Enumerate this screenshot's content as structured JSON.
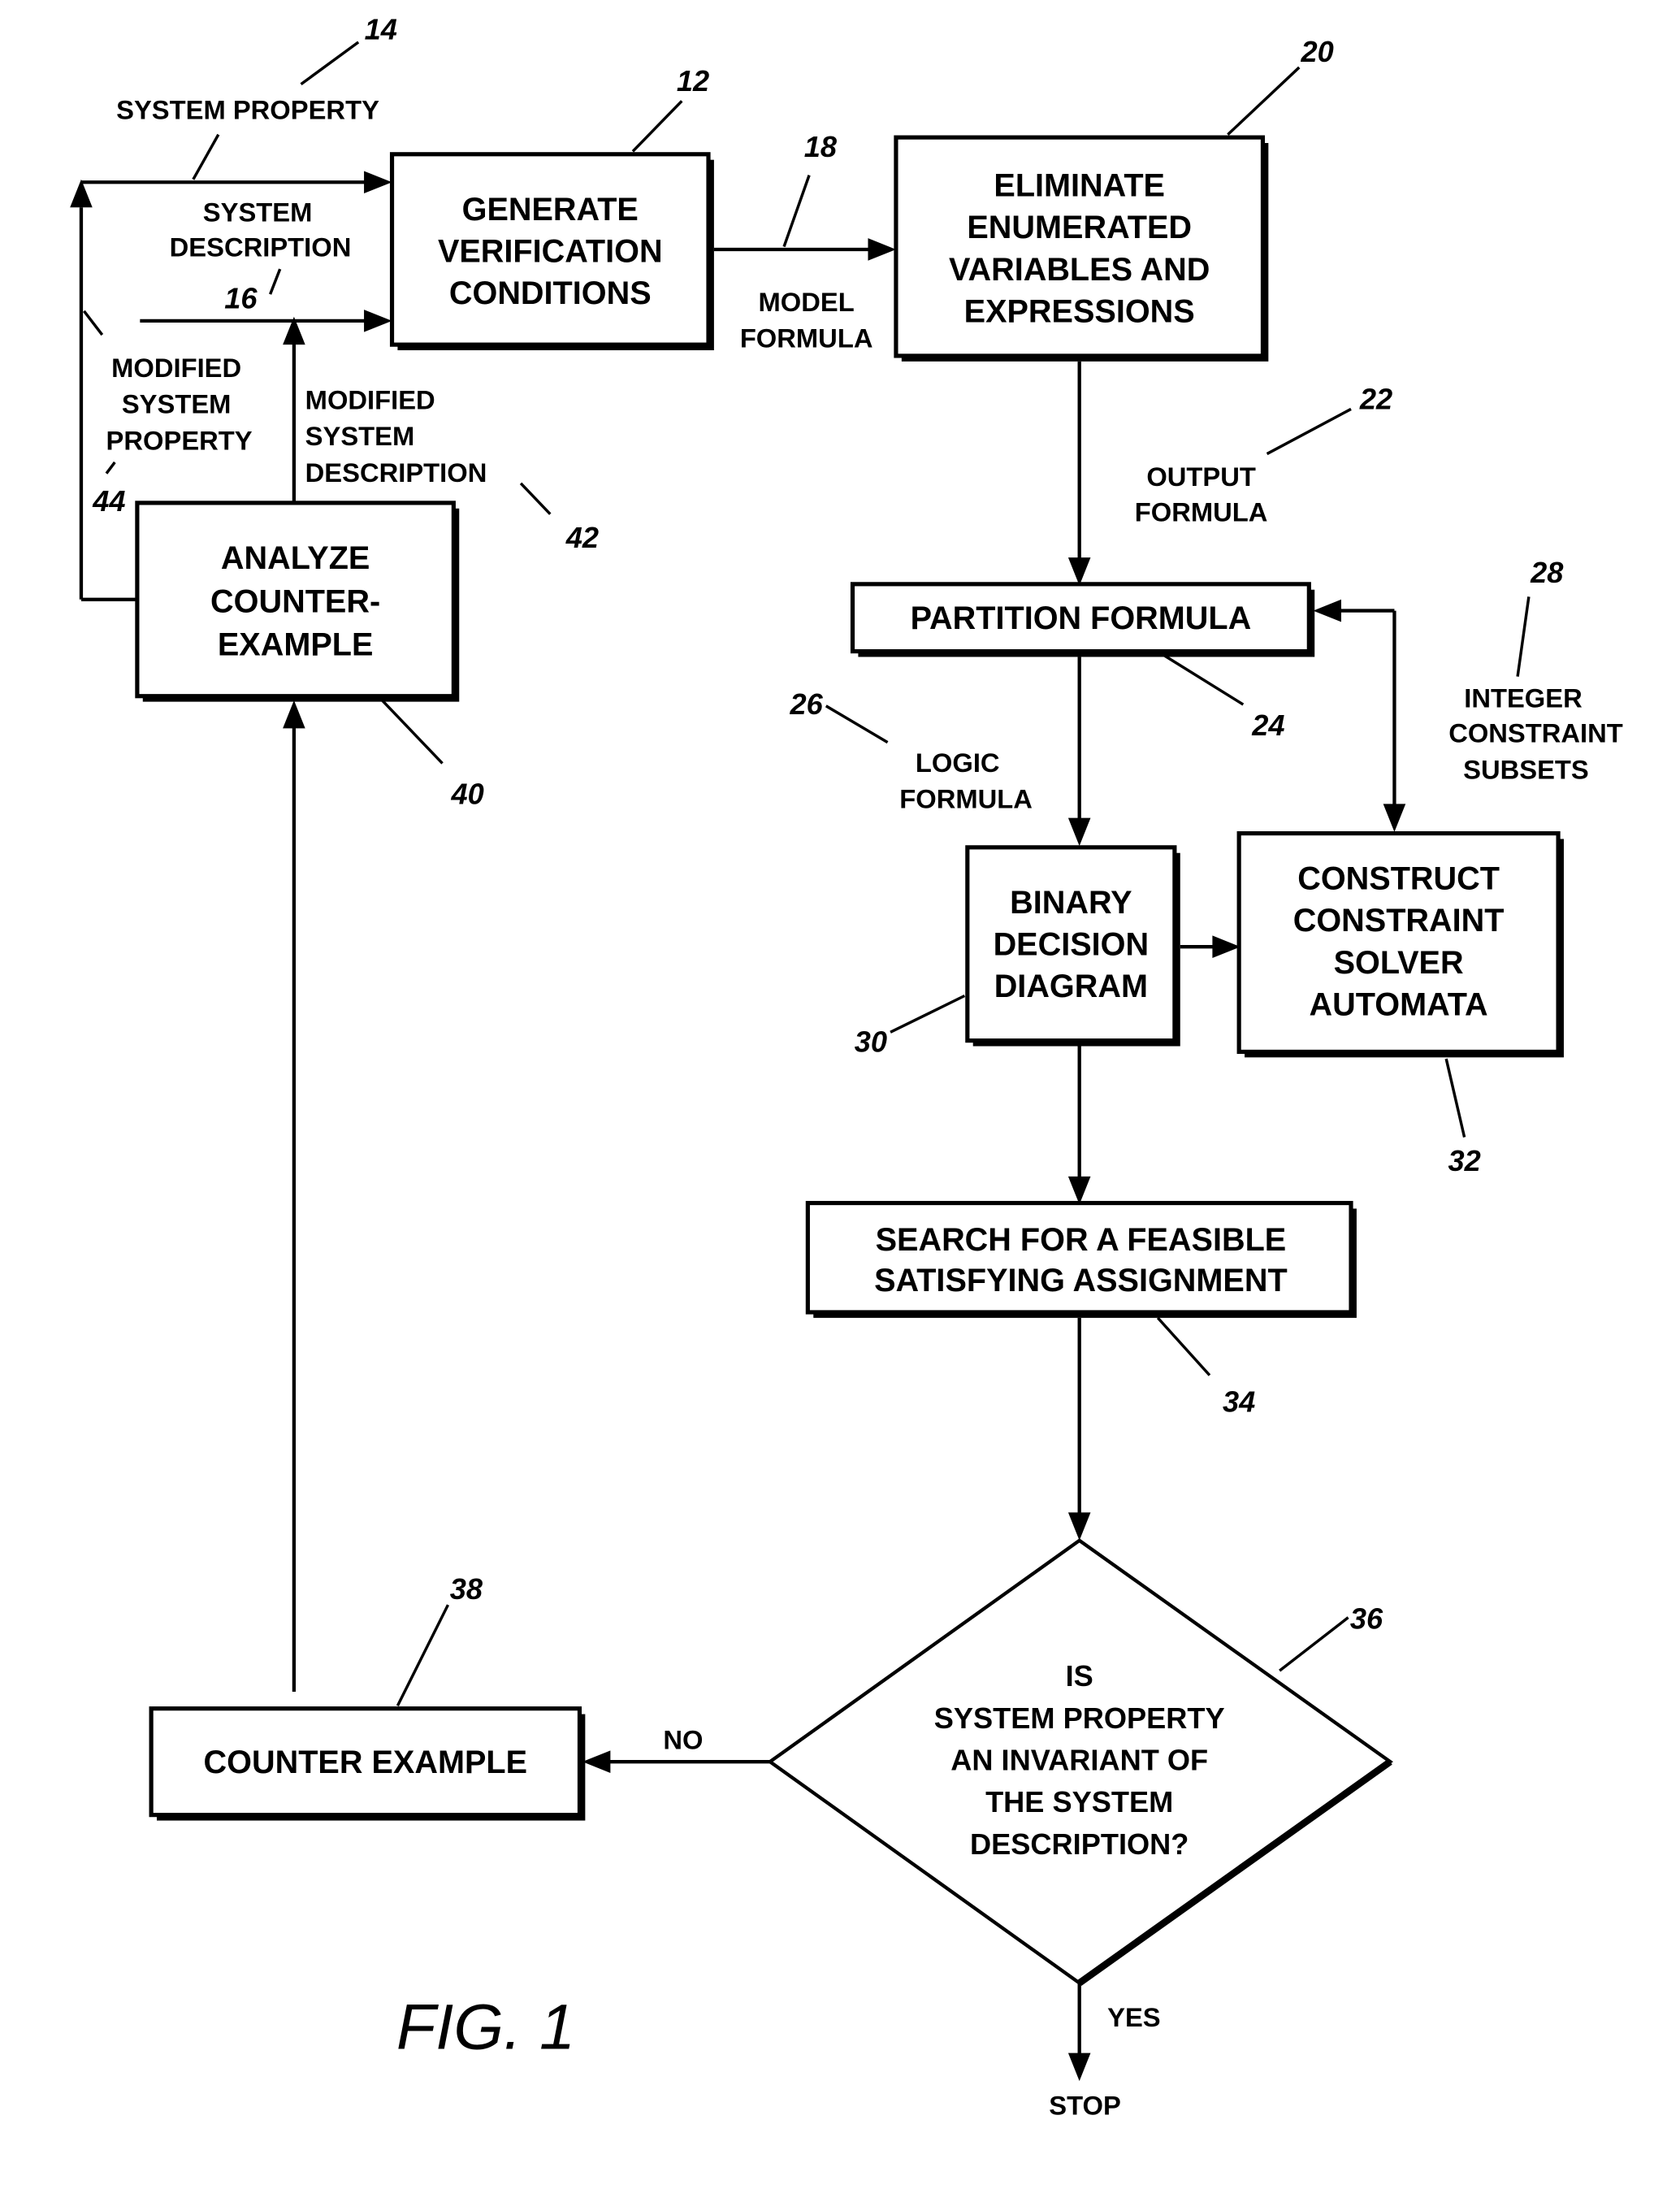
{
  "figure": {
    "caption": "FIG. 1"
  },
  "nodes": {
    "generate": {
      "ref": "12",
      "lines": [
        "GENERATE",
        "VERIFICATION",
        "CONDITIONS"
      ]
    },
    "eliminate": {
      "ref": "20",
      "lines": [
        "ELIMINATE",
        "ENUMERATED",
        "VARIABLES AND",
        "EXPRESSIONS"
      ]
    },
    "partition": {
      "ref": "24",
      "lines": [
        "PARTITION FORMULA"
      ]
    },
    "bdd": {
      "ref": "30",
      "lines": [
        "BINARY",
        "DECISION",
        "DIAGRAM"
      ]
    },
    "automata": {
      "ref": "32",
      "lines": [
        "CONSTRUCT",
        "CONSTRAINT",
        "SOLVER",
        "AUTOMATA"
      ]
    },
    "search": {
      "ref": "34",
      "lines": [
        "SEARCH FOR A FEASIBLE",
        "SATISFYING ASSIGNMENT"
      ]
    },
    "decision": {
      "ref": "36",
      "lines": [
        "IS",
        "SYSTEM PROPERTY",
        "AN INVARIANT OF",
        "THE SYSTEM",
        "DESCRIPTION?"
      ]
    },
    "counter": {
      "ref": "38",
      "lines": [
        "COUNTER EXAMPLE"
      ]
    },
    "analyze": {
      "ref": "40",
      "lines": [
        "ANALYZE",
        "COUNTER-",
        "EXAMPLE"
      ]
    }
  },
  "edge_labels": {
    "system_property": {
      "ref": "14",
      "lines": [
        "SYSTEM PROPERTY"
      ]
    },
    "system_description": {
      "ref": "16",
      "lines": [
        "SYSTEM",
        "DESCRIPTION"
      ]
    },
    "model_formula": {
      "ref": "18",
      "lines": [
        "MODEL",
        "FORMULA"
      ]
    },
    "output_formula": {
      "ref": "22",
      "lines": [
        "OUTPUT",
        "FORMULA"
      ]
    },
    "logic_formula": {
      "ref": "26",
      "lines": [
        "LOGIC",
        "FORMULA"
      ]
    },
    "integer_constraint": {
      "ref": "28",
      "lines": [
        "INTEGER",
        "CONSTRAINT",
        "SUBSETS"
      ]
    },
    "modified_description": {
      "ref": "42",
      "lines": [
        "MODIFIED",
        "SYSTEM",
        "DESCRIPTION"
      ]
    },
    "modified_property": {
      "ref": "44",
      "lines": [
        "MODIFIED",
        "SYSTEM",
        "PROPERTY"
      ]
    },
    "no": {
      "lines": [
        "NO"
      ]
    },
    "yes": {
      "lines": [
        "YES"
      ]
    },
    "stop": {
      "lines": [
        "STOP"
      ]
    }
  }
}
